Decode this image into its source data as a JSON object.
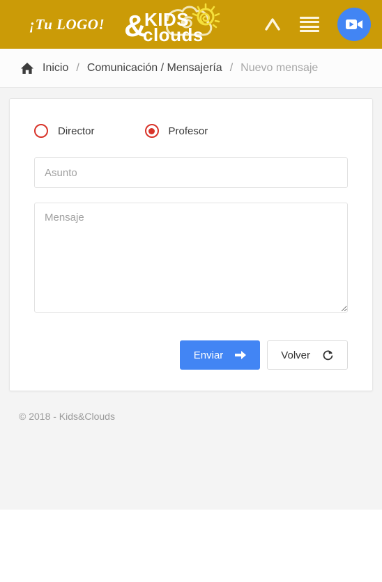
{
  "header": {
    "logo_text": "¡Tu LOGO!",
    "brand_name_line1": "KIDS",
    "brand_name_line2": "clouds",
    "brand_ampersand": "&",
    "caret_icon": "chevron-up-icon",
    "menu_icon": "hamburger-menu-icon",
    "video_icon": "video-camera-icon",
    "background_color": "#cb9b07",
    "video_button_color": "#4285f4"
  },
  "breadcrumb": {
    "home_icon": "home-icon",
    "items": [
      {
        "label": "Inicio",
        "current": false
      },
      {
        "label": "Comunicación / Mensajería",
        "current": false
      },
      {
        "label": "Nuevo mensaje",
        "current": true
      }
    ],
    "separator": "/"
  },
  "form": {
    "recipient_options": [
      {
        "label": "Director",
        "checked": false
      },
      {
        "label": "Profesor",
        "checked": true
      }
    ],
    "radio_color": "#d8342a",
    "subject": {
      "value": "",
      "placeholder": "Asunto"
    },
    "message": {
      "value": "",
      "placeholder": "Mensaje"
    },
    "buttons": {
      "submit_label": "Enviar",
      "submit_icon": "arrow-right-icon",
      "back_label": "Volver",
      "back_icon": "refresh-rotate-icon"
    }
  },
  "footer": {
    "copyright": "© 2018 - Kids&Clouds"
  }
}
